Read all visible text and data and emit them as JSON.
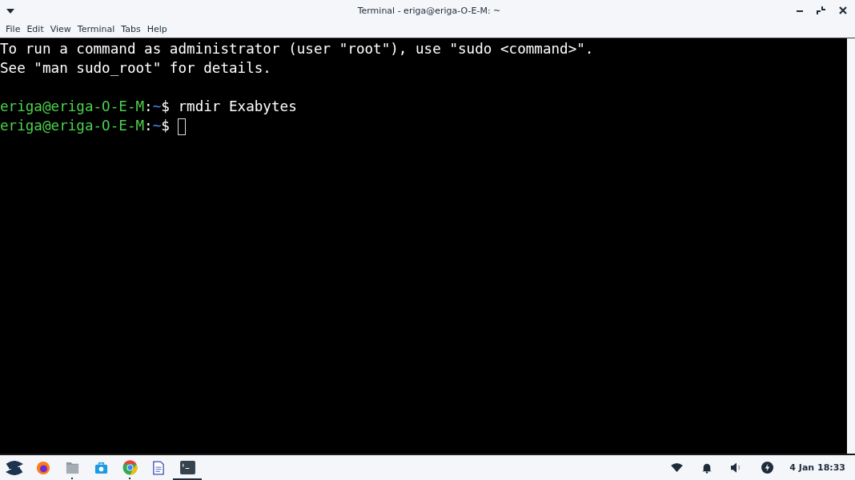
{
  "window": {
    "title": "Terminal - eriga@eriga-O-E-M: ~"
  },
  "menu": [
    "File",
    "Edit",
    "View",
    "Terminal",
    "Tabs",
    "Help"
  ],
  "terminal": {
    "lines": [
      {
        "kind": "output",
        "text": "To run a command as administrator (user \"root\"), use \"sudo <command>\"."
      },
      {
        "kind": "output",
        "text": "See \"man sudo_root\" for details."
      },
      {
        "kind": "blank"
      },
      {
        "kind": "prompt",
        "user": "eriga@eriga-O-E-M",
        "sep": ":",
        "path": "~",
        "symbol": "$",
        "command": "rmdir Exabytes",
        "cursor": false
      },
      {
        "kind": "prompt",
        "user": "eriga@eriga-O-E-M",
        "sep": ":",
        "path": "~",
        "symbol": "$",
        "cursor": true
      }
    ]
  },
  "taskbar": {
    "apps": [
      {
        "kind": "launcher",
        "running": false,
        "selected": false
      },
      {
        "kind": "firefox",
        "running": false,
        "selected": false
      },
      {
        "kind": "files",
        "running": true,
        "selected": false
      },
      {
        "kind": "store",
        "running": false,
        "selected": false
      },
      {
        "kind": "chrome",
        "running": true,
        "selected": false
      },
      {
        "kind": "document",
        "running": false,
        "selected": false
      },
      {
        "kind": "terminal",
        "running": true,
        "selected": true
      }
    ],
    "tray": [
      {
        "kind": "wifi"
      },
      {
        "kind": "bell"
      },
      {
        "kind": "volume"
      },
      {
        "kind": "power"
      }
    ],
    "clock": "4 Jan 18:33"
  }
}
